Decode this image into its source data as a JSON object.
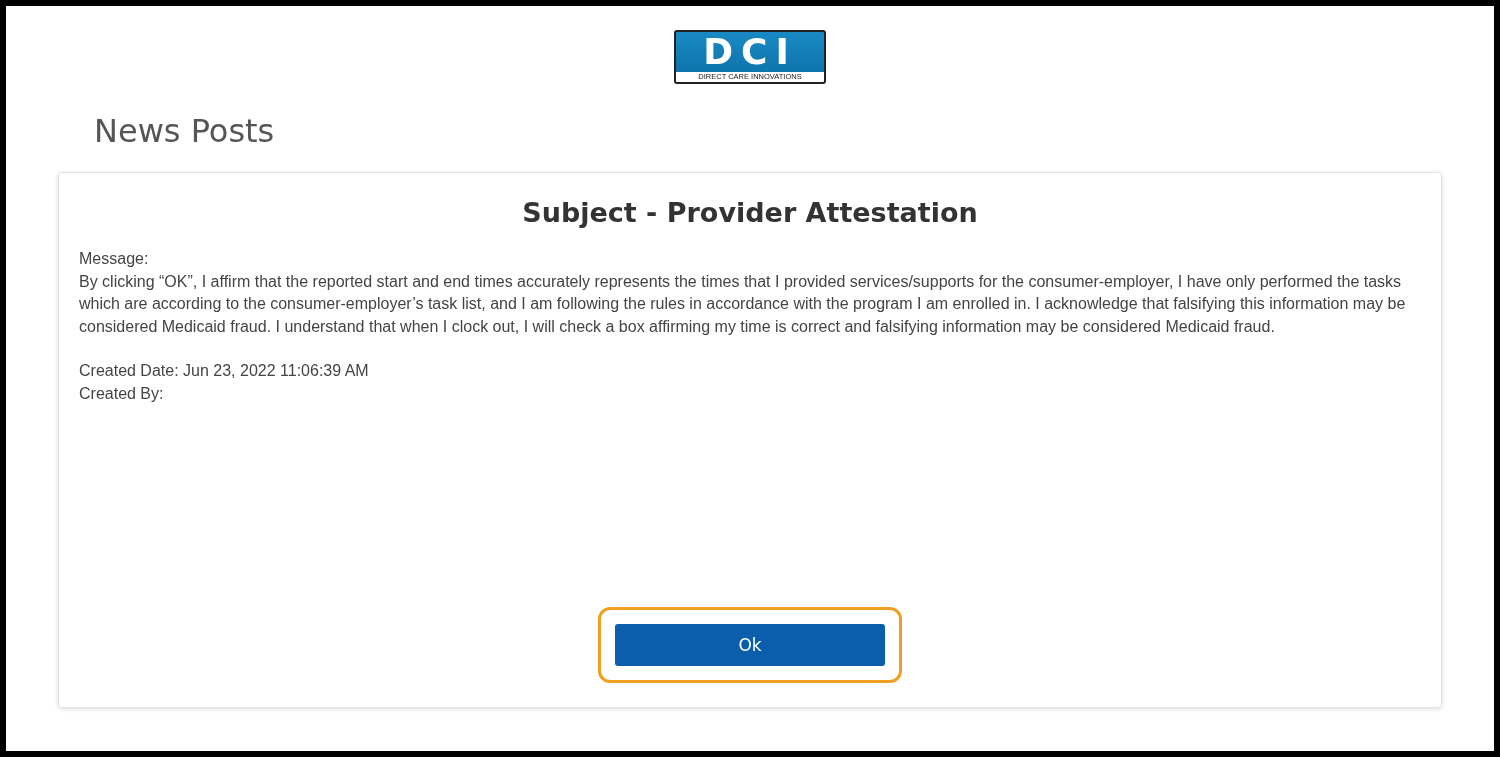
{
  "logo": {
    "mark": "DCI",
    "tagline": "DIRECT CARE INNOVATIONS"
  },
  "page_title": "News Posts",
  "post": {
    "subject": "Subject - Provider Attestation",
    "message_label": "Message:",
    "message": "By clicking “OK”, I affirm that the reported start and end times accurately represents the times that I provided services/supports for the consumer-employer, I have only performed the tasks which are according to the consumer-employer’s task list, and I am following the rules in accordance with the program I am enrolled in. I acknowledge that falsifying this information may be considered Medicaid fraud. I understand that when I clock out, I will check a box affirming my time is correct and falsifying information may be considered Medicaid fraud.",
    "created_date": "Created Date: Jun 23, 2022 11:06:39 AM",
    "created_by": "Created By:"
  },
  "ok_button": {
    "label": "Ok",
    "highlighted": true
  }
}
